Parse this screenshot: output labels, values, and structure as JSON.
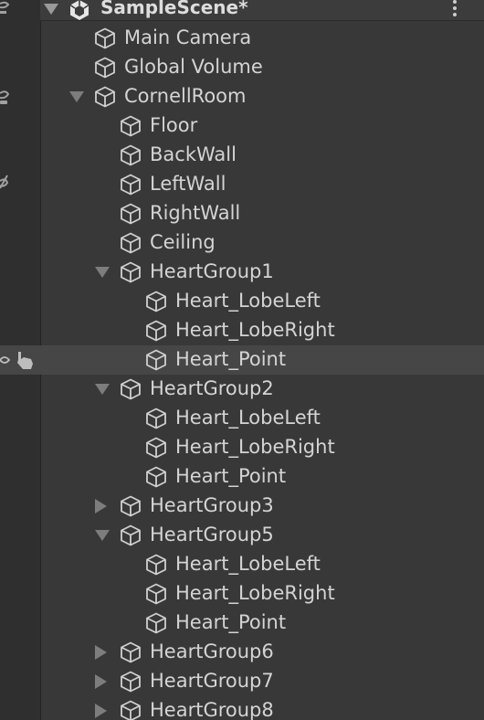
{
  "scene": {
    "title": "SampleScene*",
    "icon": "unity-logo-icon",
    "menu_icon": "kebab-menu-icon"
  },
  "hierarchy": [
    {
      "label": "Main Camera",
      "depth": 0,
      "fold": "none"
    },
    {
      "label": "Global Volume",
      "depth": 0,
      "fold": "none"
    },
    {
      "label": "CornellRoom",
      "depth": 0,
      "fold": "open"
    },
    {
      "label": "Floor",
      "depth": 1,
      "fold": "none"
    },
    {
      "label": "BackWall",
      "depth": 1,
      "fold": "none"
    },
    {
      "label": "LeftWall",
      "depth": 1,
      "fold": "none"
    },
    {
      "label": "RightWall",
      "depth": 1,
      "fold": "none"
    },
    {
      "label": "Ceiling",
      "depth": 1,
      "fold": "none"
    },
    {
      "label": "HeartGroup1",
      "depth": 1,
      "fold": "open"
    },
    {
      "label": "Heart_LobeLeft",
      "depth": 2,
      "fold": "none"
    },
    {
      "label": "Heart_LobeRight",
      "depth": 2,
      "fold": "none"
    },
    {
      "label": "Heart_Point",
      "depth": 2,
      "fold": "none",
      "hovered": true
    },
    {
      "label": "HeartGroup2",
      "depth": 1,
      "fold": "open"
    },
    {
      "label": "Heart_LobeLeft",
      "depth": 2,
      "fold": "none"
    },
    {
      "label": "Heart_LobeRight",
      "depth": 2,
      "fold": "none"
    },
    {
      "label": "Heart_Point",
      "depth": 2,
      "fold": "none"
    },
    {
      "label": "HeartGroup3",
      "depth": 1,
      "fold": "closed"
    },
    {
      "label": "HeartGroup5",
      "depth": 1,
      "fold": "open"
    },
    {
      "label": "Heart_LobeLeft",
      "depth": 2,
      "fold": "none"
    },
    {
      "label": "Heart_LobeRight",
      "depth": 2,
      "fold": "none"
    },
    {
      "label": "Heart_Point",
      "depth": 2,
      "fold": "none"
    },
    {
      "label": "HeartGroup6",
      "depth": 1,
      "fold": "closed"
    },
    {
      "label": "HeartGroup7",
      "depth": 1,
      "fold": "closed"
    },
    {
      "label": "HeartGroup8",
      "depth": 1,
      "fold": "closed"
    }
  ],
  "gutter_icons": [
    "scene-visibility-icon",
    "scene-pickable-icon",
    "pick-disabled-icon"
  ],
  "hover_icons": [
    "visibility-eye-icon",
    "pointer-hand-icon"
  ],
  "colors": {
    "background": "#383838",
    "gutter": "#2f2f2f",
    "hover_row": "#464646",
    "text": "#d4d4d4"
  }
}
